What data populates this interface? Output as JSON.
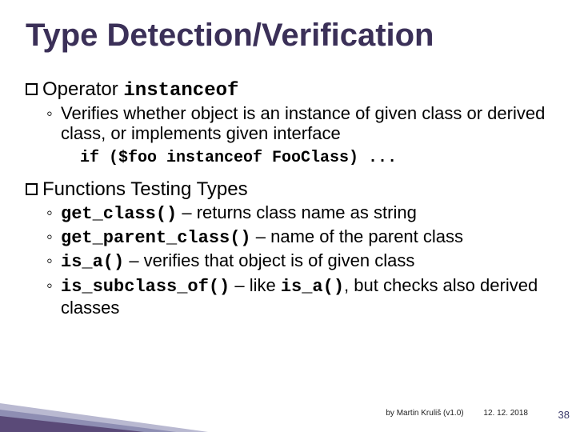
{
  "title": "Type Detection/Verification",
  "section1": {
    "label_prefix": "Operator",
    "label_mono": "instanceof",
    "desc": "Verifies whether object is an instance of given class or derived class, or implements given interface",
    "code": "if ($foo instanceof FooClass) ..."
  },
  "section2": {
    "label": "Functions Testing Types",
    "items": [
      {
        "fn": "get_class()",
        "rest": " – returns class name as string"
      },
      {
        "fn": "get_parent_class()",
        "rest": " – name of the parent class"
      },
      {
        "fn": "is_a()",
        "rest": " – verifies that object is of given class"
      },
      {
        "fn": "is_subclass_of()",
        "rest_a": " – like ",
        "fn2": "is_a()",
        "rest_b": ", but checks also derived classes"
      }
    ]
  },
  "footer": {
    "by": "by Martin Kruliš (v1.0)",
    "date": "12. 12. 2018",
    "page": "38"
  }
}
